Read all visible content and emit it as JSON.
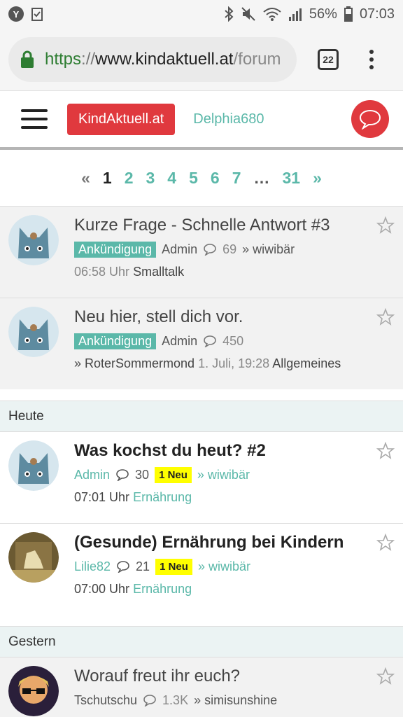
{
  "status": {
    "notif_letter": "Y",
    "battery": "56%",
    "time": "07:03"
  },
  "browser": {
    "url_scheme": "https",
    "url_sep": "://",
    "url_host": "www.kindaktuell.at",
    "url_path": "/forum",
    "tab_count": "22"
  },
  "header": {
    "brand": "KindAktuell.at",
    "username": "Delphia680"
  },
  "pagination": {
    "prev": "«",
    "next": "»",
    "pages": [
      "1",
      "2",
      "3",
      "4",
      "5",
      "6",
      "7"
    ],
    "ellipsis": "…",
    "last": "31"
  },
  "topics": [
    {
      "title": "Kurze Frage - Schnelle Antwort #3",
      "tag": "Ankündigung",
      "author": "Admin",
      "replies": "69",
      "last_poster": "» wiwibär",
      "time": "06:58 Uhr",
      "category": "Smalltalk"
    },
    {
      "title": "Neu hier, stell dich vor.",
      "tag": "Ankündigung",
      "author": "Admin",
      "replies": "450",
      "last_poster": "» RoterSommermond",
      "time": "1. Juli, 19:28",
      "category": "Allgemeines"
    }
  ],
  "sections": {
    "today": "Heute",
    "yesterday": "Gestern"
  },
  "today_topics": [
    {
      "title": "Was kochst du heut? #2",
      "author": "Admin",
      "replies": "30",
      "new_badge": "1 Neu",
      "last_poster": "» wiwibär",
      "time": "07:01 Uhr",
      "category": "Ernährung"
    },
    {
      "title": "(Gesunde) Ernährung bei Kindern",
      "author": "Lilie82",
      "replies": "21",
      "new_badge": "1 Neu",
      "last_poster": "» wiwibär",
      "time": "07:00 Uhr",
      "category": "Ernährung"
    }
  ],
  "yesterday_topics": [
    {
      "title": "Worauf freut ihr euch?",
      "author": "Tschutschu",
      "replies": "1.3K",
      "last_poster": "» simisunshine"
    }
  ],
  "colors": {
    "accent": "#5bb8a9",
    "brand_red": "#e0393e",
    "new_yellow": "#ffff00"
  },
  "icons": [
    "bluetooth-icon",
    "mute-icon",
    "wifi-icon",
    "signal-icon",
    "battery-icon",
    "lock-icon",
    "comment-icon",
    "star-icon",
    "chat-icon"
  ]
}
